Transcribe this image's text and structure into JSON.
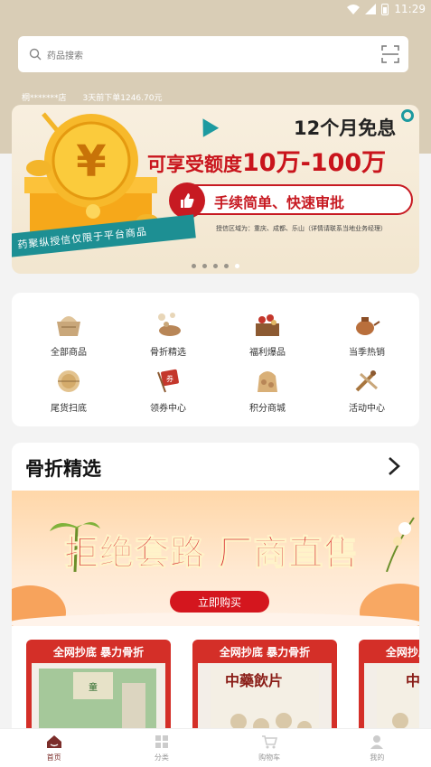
{
  "status_bar": {
    "time": "11:29"
  },
  "search": {
    "placeholder": "药品搜索"
  },
  "order_ticker": {
    "store": "桐*******店",
    "message": "3天前下单1246.70元"
  },
  "banner": {
    "title": "12个月免息",
    "headline_prefix": "可享受额度",
    "headline_amount": "10万-100万",
    "pill_text": "手续简单、快速审批",
    "area_note": "授信区域为：重庆、成都、乐山（详情请联系当地业务经理）",
    "ribbon_text": "药聚纵授信仅限于平台商品",
    "dots_count": 5,
    "active_dot": 4
  },
  "categories": [
    {
      "label": "全部商品",
      "icon": "all-products-icon"
    },
    {
      "label": "骨折精选",
      "icon": "fracture-select-icon"
    },
    {
      "label": "福利爆品",
      "icon": "welfare-hot-icon"
    },
    {
      "label": "当季热销",
      "icon": "seasonal-hot-icon"
    },
    {
      "label": "尾货扫底",
      "icon": "clearance-icon"
    },
    {
      "label": "领券中心",
      "icon": "coupon-center-icon"
    },
    {
      "label": "积分商城",
      "icon": "points-mall-icon"
    },
    {
      "label": "活动中心",
      "icon": "activity-center-icon"
    }
  ],
  "section": {
    "title": "骨折精选",
    "promo_slogan": "拒绝套路 厂商直售",
    "promo_button": "立即购买"
  },
  "products": [
    {
      "tag": "全网抄底 暴力骨折",
      "label": ""
    },
    {
      "tag": "全网抄底 暴力骨折",
      "label": "中藥飲片"
    },
    {
      "tag": "全网抄底 暴力骨折",
      "label": "中"
    }
  ],
  "nav": [
    {
      "label": "首页",
      "icon": "home-icon",
      "active": true
    },
    {
      "label": "分类",
      "icon": "category-icon",
      "active": false
    },
    {
      "label": "购物车",
      "icon": "cart-icon",
      "active": false
    },
    {
      "label": "我的",
      "icon": "profile-icon",
      "active": false
    }
  ],
  "colors": {
    "accent": "#c71a22",
    "brand_bg": "#d9cdb6",
    "teal": "#1d8f93",
    "nav_active": "#7b2d2a"
  }
}
